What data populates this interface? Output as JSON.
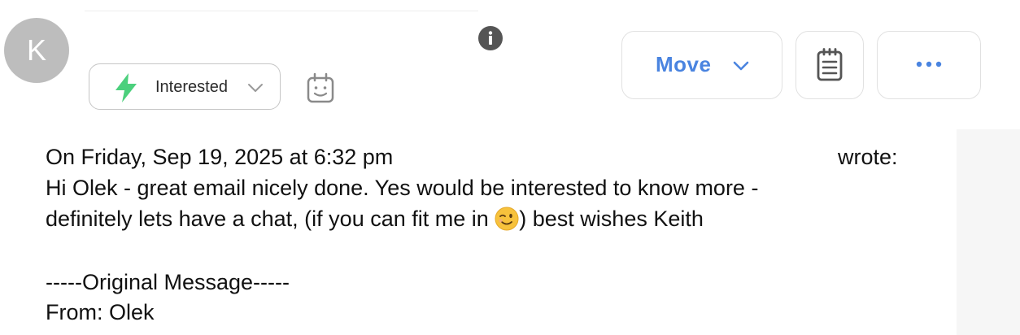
{
  "avatar": {
    "initial": "K"
  },
  "status": {
    "label": "Interested",
    "color": "#4cd07d"
  },
  "toolbar": {
    "move_label": "Move",
    "accent": "#4a84e0"
  },
  "icons": {
    "info": "info-icon",
    "bolt": "lightning-bolt-icon",
    "calendar": "calendar-face-icon",
    "notes": "notepad-icon",
    "more": "ellipsis-icon"
  },
  "email": {
    "header_prefix": "On Friday, Sep 19, 2025 at 6:32 pm",
    "header_suffix": "wrote:",
    "line1": "Hi Olek - great email nicely done. Yes would be interested to know more -",
    "line2_before_emoji": "definitely lets have a chat, (if you can fit me in ",
    "emoji": "😉",
    "line2_after_emoji": ") best wishes Keith",
    "original_marker": "-----Original Message-----",
    "from_line": "From: Olek"
  }
}
